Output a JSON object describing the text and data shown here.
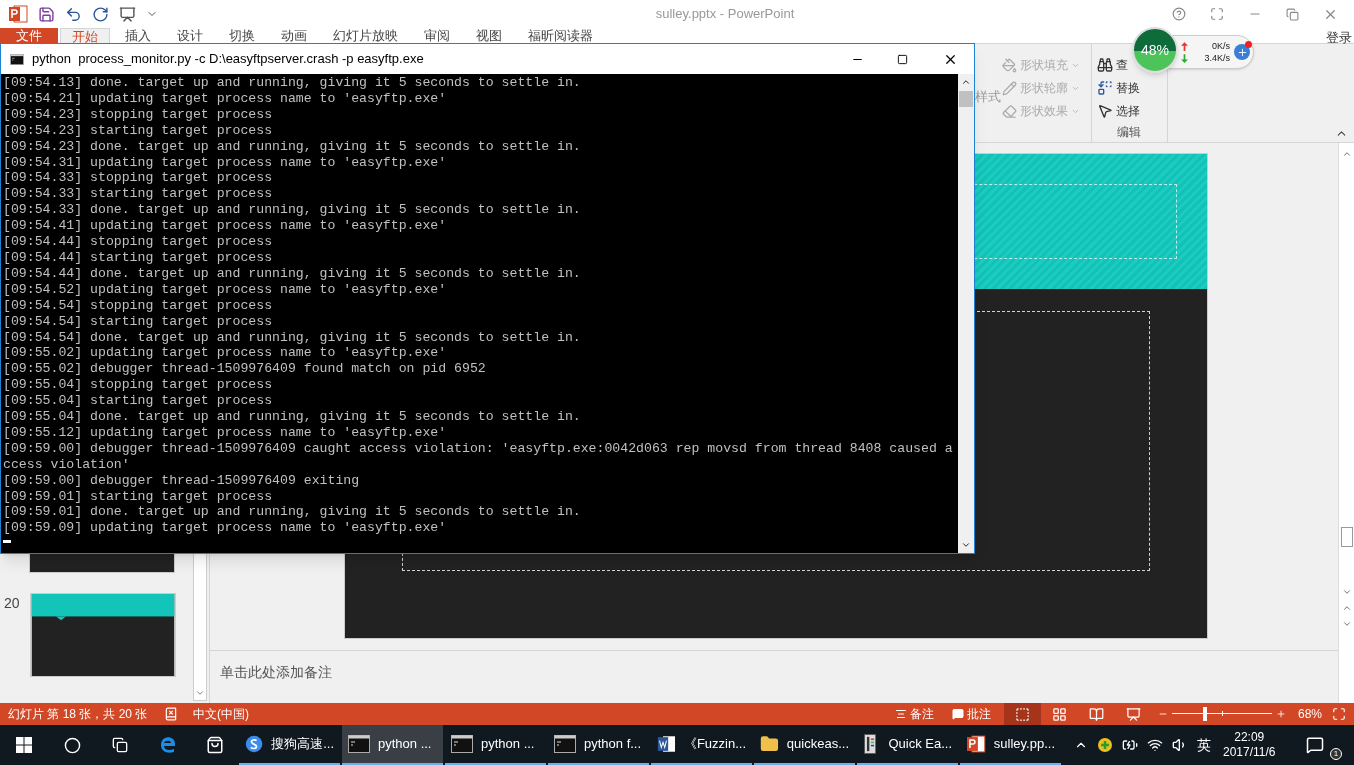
{
  "powerpoint": {
    "title": "sulley.pptx - PowerPoint",
    "account": "登录",
    "tabs": [
      {
        "label": "文件",
        "kind": "file",
        "selected": false
      },
      {
        "label": "开始",
        "kind": "tab",
        "selected": true
      },
      {
        "label": "插入",
        "kind": "tab",
        "selected": false
      },
      {
        "label": "设计",
        "kind": "tab",
        "selected": false
      },
      {
        "label": "切换",
        "kind": "tab",
        "selected": false
      },
      {
        "label": "动画",
        "kind": "tab",
        "selected": false
      },
      {
        "label": "幻灯片放映",
        "kind": "tab",
        "selected": false
      },
      {
        "label": "审阅",
        "kind": "tab",
        "selected": false
      },
      {
        "label": "视图",
        "kind": "tab",
        "selected": false
      },
      {
        "label": "福昕阅读器",
        "kind": "tab",
        "selected": false
      }
    ],
    "ribbon": {
      "style_label": "样式",
      "shape_commands": [
        {
          "label": "形状填充",
          "kind": "fill",
          "disabled": true
        },
        {
          "label": "形状轮廓",
          "kind": "outline",
          "disabled": true
        },
        {
          "label": "形状效果",
          "kind": "effect",
          "disabled": true
        }
      ],
      "edit_commands": [
        {
          "label": "查",
          "kind": "find"
        },
        {
          "label": "替换",
          "kind": "replace"
        },
        {
          "label": "选择",
          "kind": "select"
        }
      ],
      "edit_group": "编辑"
    },
    "slide_panel": {
      "slide_number": "20"
    },
    "notes_placeholder": "单击此处添加备注",
    "status_bar": {
      "slide_info": "幻灯片 第 18 张，共 20 张",
      "language": "中文(中国)",
      "notes": "备注",
      "comments": "批注",
      "views": [
        {
          "kind": "normal",
          "selected": true
        },
        {
          "kind": "sorter",
          "selected": false
        },
        {
          "kind": "reading",
          "selected": false
        },
        {
          "kind": "show",
          "selected": false
        }
      ],
      "zoom": {
        "level": 0.33
      },
      "zoom_reading": "68%"
    }
  },
  "network_widget": {
    "percent": "48%",
    "upload": "0K/s",
    "download": "3.4K/s"
  },
  "console": {
    "title": "python  process_monitor.py -c D:\\easyftpserver.crash -p easyftp.exe",
    "lines": [
      "[09:54.13] done. target up and running, giving it 5 seconds to settle in.",
      "[09:54.21] updating target process name to 'easyftp.exe'",
      "[09:54.23] stopping target process",
      "[09:54.23] starting target process",
      "[09:54.23] done. target up and running, giving it 5 seconds to settle in.",
      "[09:54.31] updating target process name to 'easyftp.exe'",
      "[09:54.33] stopping target process",
      "[09:54.33] starting target process",
      "[09:54.33] done. target up and running, giving it 5 seconds to settle in.",
      "[09:54.41] updating target process name to 'easyftp.exe'",
      "[09:54.44] stopping target process",
      "[09:54.44] starting target process",
      "[09:54.44] done. target up and running, giving it 5 seconds to settle in.",
      "[09:54.52] updating target process name to 'easyftp.exe'",
      "[09:54.54] stopping target process",
      "[09:54.54] starting target process",
      "[09:54.54] done. target up and running, giving it 5 seconds to settle in.",
      "[09:55.02] updating target process name to 'easyftp.exe'",
      "[09:55.02] debugger thread-1509976409 found match on pid 6952",
      "[09:55.04] stopping target process",
      "[09:55.04] starting target process",
      "[09:55.04] done. target up and running, giving it 5 seconds to settle in.",
      "[09:55.12] updating target process name to 'easyftp.exe'",
      "[09:59.00] debugger thread-1509976409 caught access violation: 'easyftp.exe:0042d063 rep movsd from thread 8408 caused access violation'",
      "[09:59.00] debugger thread-1509976409 exiting",
      "[09:59.01] starting target process",
      "[09:59.01] done. target up and running, giving it 5 seconds to settle in.",
      "[09:59.09] updating target process name to 'easyftp.exe'"
    ]
  },
  "taskbar": {
    "apps": [
      {
        "label": "搜狗高速...",
        "kind": "sogou",
        "selected": false
      },
      {
        "label": "python ...",
        "kind": "console",
        "selected": true
      },
      {
        "label": "python ...",
        "kind": "console",
        "selected": false
      },
      {
        "label": "python f...",
        "kind": "console",
        "selected": false
      },
      {
        "label": "《Fuzzin...",
        "kind": "word",
        "selected": false
      },
      {
        "label": "quickeas...",
        "kind": "folder",
        "selected": false
      },
      {
        "label": "Quick Ea...",
        "kind": "server",
        "selected": false
      },
      {
        "label": "sulley.pp...",
        "kind": "ppt",
        "selected": false
      }
    ],
    "input_method": "英",
    "time": "22:09",
    "date": "2017/11/6",
    "notification_count": "1"
  }
}
